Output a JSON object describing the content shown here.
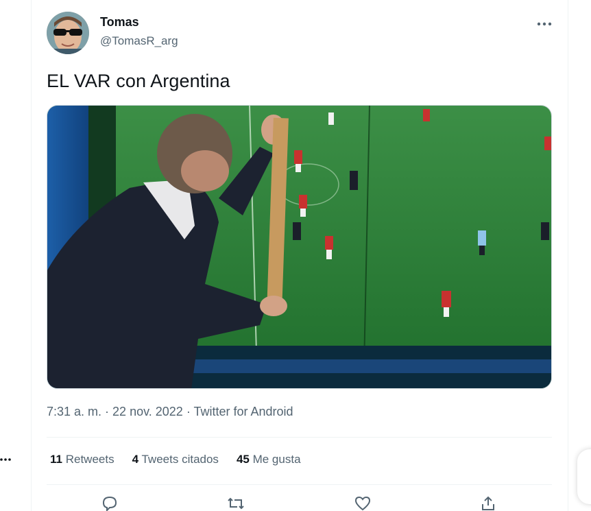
{
  "tweet": {
    "display_name": "Tomas",
    "handle": "@TomasR_arg",
    "text": "EL VAR con Argentina",
    "time": "7:31 a. m.",
    "date": "22 nov. 2022",
    "source": "Twitter for Android",
    "separator": " · "
  },
  "stats": {
    "retweets_count": "11",
    "retweets_label": "Retweets",
    "quotes_count": "4",
    "quotes_label": "Tweets citados",
    "likes_count": "45",
    "likes_label": "Me gusta"
  },
  "icons": {
    "more": "more-horizontal-icon",
    "reply": "reply-icon",
    "retweet": "retweet-icon",
    "like": "heart-icon",
    "share": "share-icon"
  },
  "colors": {
    "text_primary": "#0f1419",
    "text_secondary": "#536471",
    "border": "#eff3f4",
    "pitch_green": "#2e8b3a"
  }
}
